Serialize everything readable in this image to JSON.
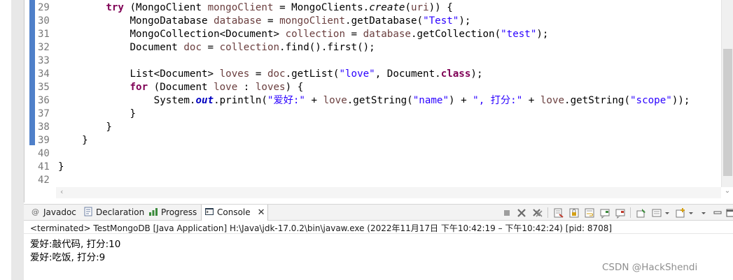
{
  "editor": {
    "line_numbers": [
      "29",
      "30",
      "31",
      "32",
      "33",
      "34",
      "35",
      "36",
      "37",
      "38",
      "39",
      "40",
      "41",
      "42"
    ],
    "lines": [
      [
        {
          "t": "        "
        },
        {
          "t": "try",
          "c": "kw"
        },
        {
          "t": " (MongoClient "
        },
        {
          "t": "mongoClient",
          "c": "var"
        },
        {
          "t": " = MongoClients."
        },
        {
          "t": "create",
          "c": "it"
        },
        {
          "t": "("
        },
        {
          "t": "uri",
          "c": "var"
        },
        {
          "t": ")) {"
        }
      ],
      [
        {
          "t": "            MongoDatabase "
        },
        {
          "t": "database",
          "c": "var"
        },
        {
          "t": " = "
        },
        {
          "t": "mongoClient",
          "c": "var"
        },
        {
          "t": ".getDatabase("
        },
        {
          "t": "\"Test\"",
          "c": "str"
        },
        {
          "t": ");"
        }
      ],
      [
        {
          "t": "            MongoCollection<Document> "
        },
        {
          "t": "collection",
          "c": "var"
        },
        {
          "t": " = "
        },
        {
          "t": "database",
          "c": "var"
        },
        {
          "t": ".getCollection("
        },
        {
          "t": "\"test\"",
          "c": "str"
        },
        {
          "t": ");"
        }
      ],
      [
        {
          "t": "            Document "
        },
        {
          "t": "doc",
          "c": "var"
        },
        {
          "t": " = "
        },
        {
          "t": "collection",
          "c": "var"
        },
        {
          "t": ".find().first();"
        }
      ],
      [
        {
          "t": ""
        }
      ],
      [
        {
          "t": "            List<Document> "
        },
        {
          "t": "loves",
          "c": "var"
        },
        {
          "t": " = "
        },
        {
          "t": "doc",
          "c": "var"
        },
        {
          "t": ".getList("
        },
        {
          "t": "\"love\"",
          "c": "str"
        },
        {
          "t": ", Document."
        },
        {
          "t": "class",
          "c": "kw"
        },
        {
          "t": ");"
        }
      ],
      [
        {
          "t": "            "
        },
        {
          "t": "for",
          "c": "kw"
        },
        {
          "t": " (Document "
        },
        {
          "t": "love",
          "c": "var"
        },
        {
          "t": " : "
        },
        {
          "t": "loves",
          "c": "var"
        },
        {
          "t": ") {"
        }
      ],
      [
        {
          "t": "                System."
        },
        {
          "t": "out",
          "c": "fldi"
        },
        {
          "t": ".println("
        },
        {
          "t": "\"爱好:\"",
          "c": "str"
        },
        {
          "t": " + "
        },
        {
          "t": "love",
          "c": "var"
        },
        {
          "t": ".getString("
        },
        {
          "t": "\"name\"",
          "c": "str"
        },
        {
          "t": ") + "
        },
        {
          "t": "\", 打分:\"",
          "c": "str"
        },
        {
          "t": " + "
        },
        {
          "t": "love",
          "c": "var"
        },
        {
          "t": ".getString("
        },
        {
          "t": "\"scope\"",
          "c": "str"
        },
        {
          "t": "));"
        }
      ],
      [
        {
          "t": "            }"
        }
      ],
      [
        {
          "t": "        }"
        }
      ],
      [
        {
          "t": "    }"
        }
      ],
      [
        {
          "t": ""
        }
      ],
      [
        {
          "t": "}"
        }
      ],
      [
        {
          "t": ""
        }
      ]
    ]
  },
  "tabs": {
    "javadoc": "Javadoc",
    "declaration": "Declaration",
    "progress": "Progress",
    "console": "Console",
    "close_glyph": "✕"
  },
  "console": {
    "terminated_line": "<terminated> TestMongoDB [Java Application] H:\\Java\\jdk-17.0.2\\bin\\javaw.exe  (2022年11月17日 下午10:42:19 – 下午10:42:24) [pid: 8708]",
    "output": [
      "爱好:敲代码, 打分:10",
      "爱好:吃饭, 打分:9"
    ]
  },
  "watermark": "CSDN @HackShendi",
  "colors": {
    "keyword": "#7f0055",
    "string": "#2a00ff",
    "local_variable": "#6a3e3e",
    "static_field": "#0000c0",
    "ruler_mark": "#4f80c9"
  },
  "icons": [
    "javadoc-icon",
    "declaration-icon",
    "progress-icon",
    "console-icon",
    "stop-icon",
    "remove-launch-icon",
    "remove-all-icon",
    "scroll-lock-icon",
    "word-wrap-icon",
    "pin-console-icon",
    "display-console-icon",
    "open-console-icon",
    "view-menu-icon",
    "minimize-icon"
  ]
}
